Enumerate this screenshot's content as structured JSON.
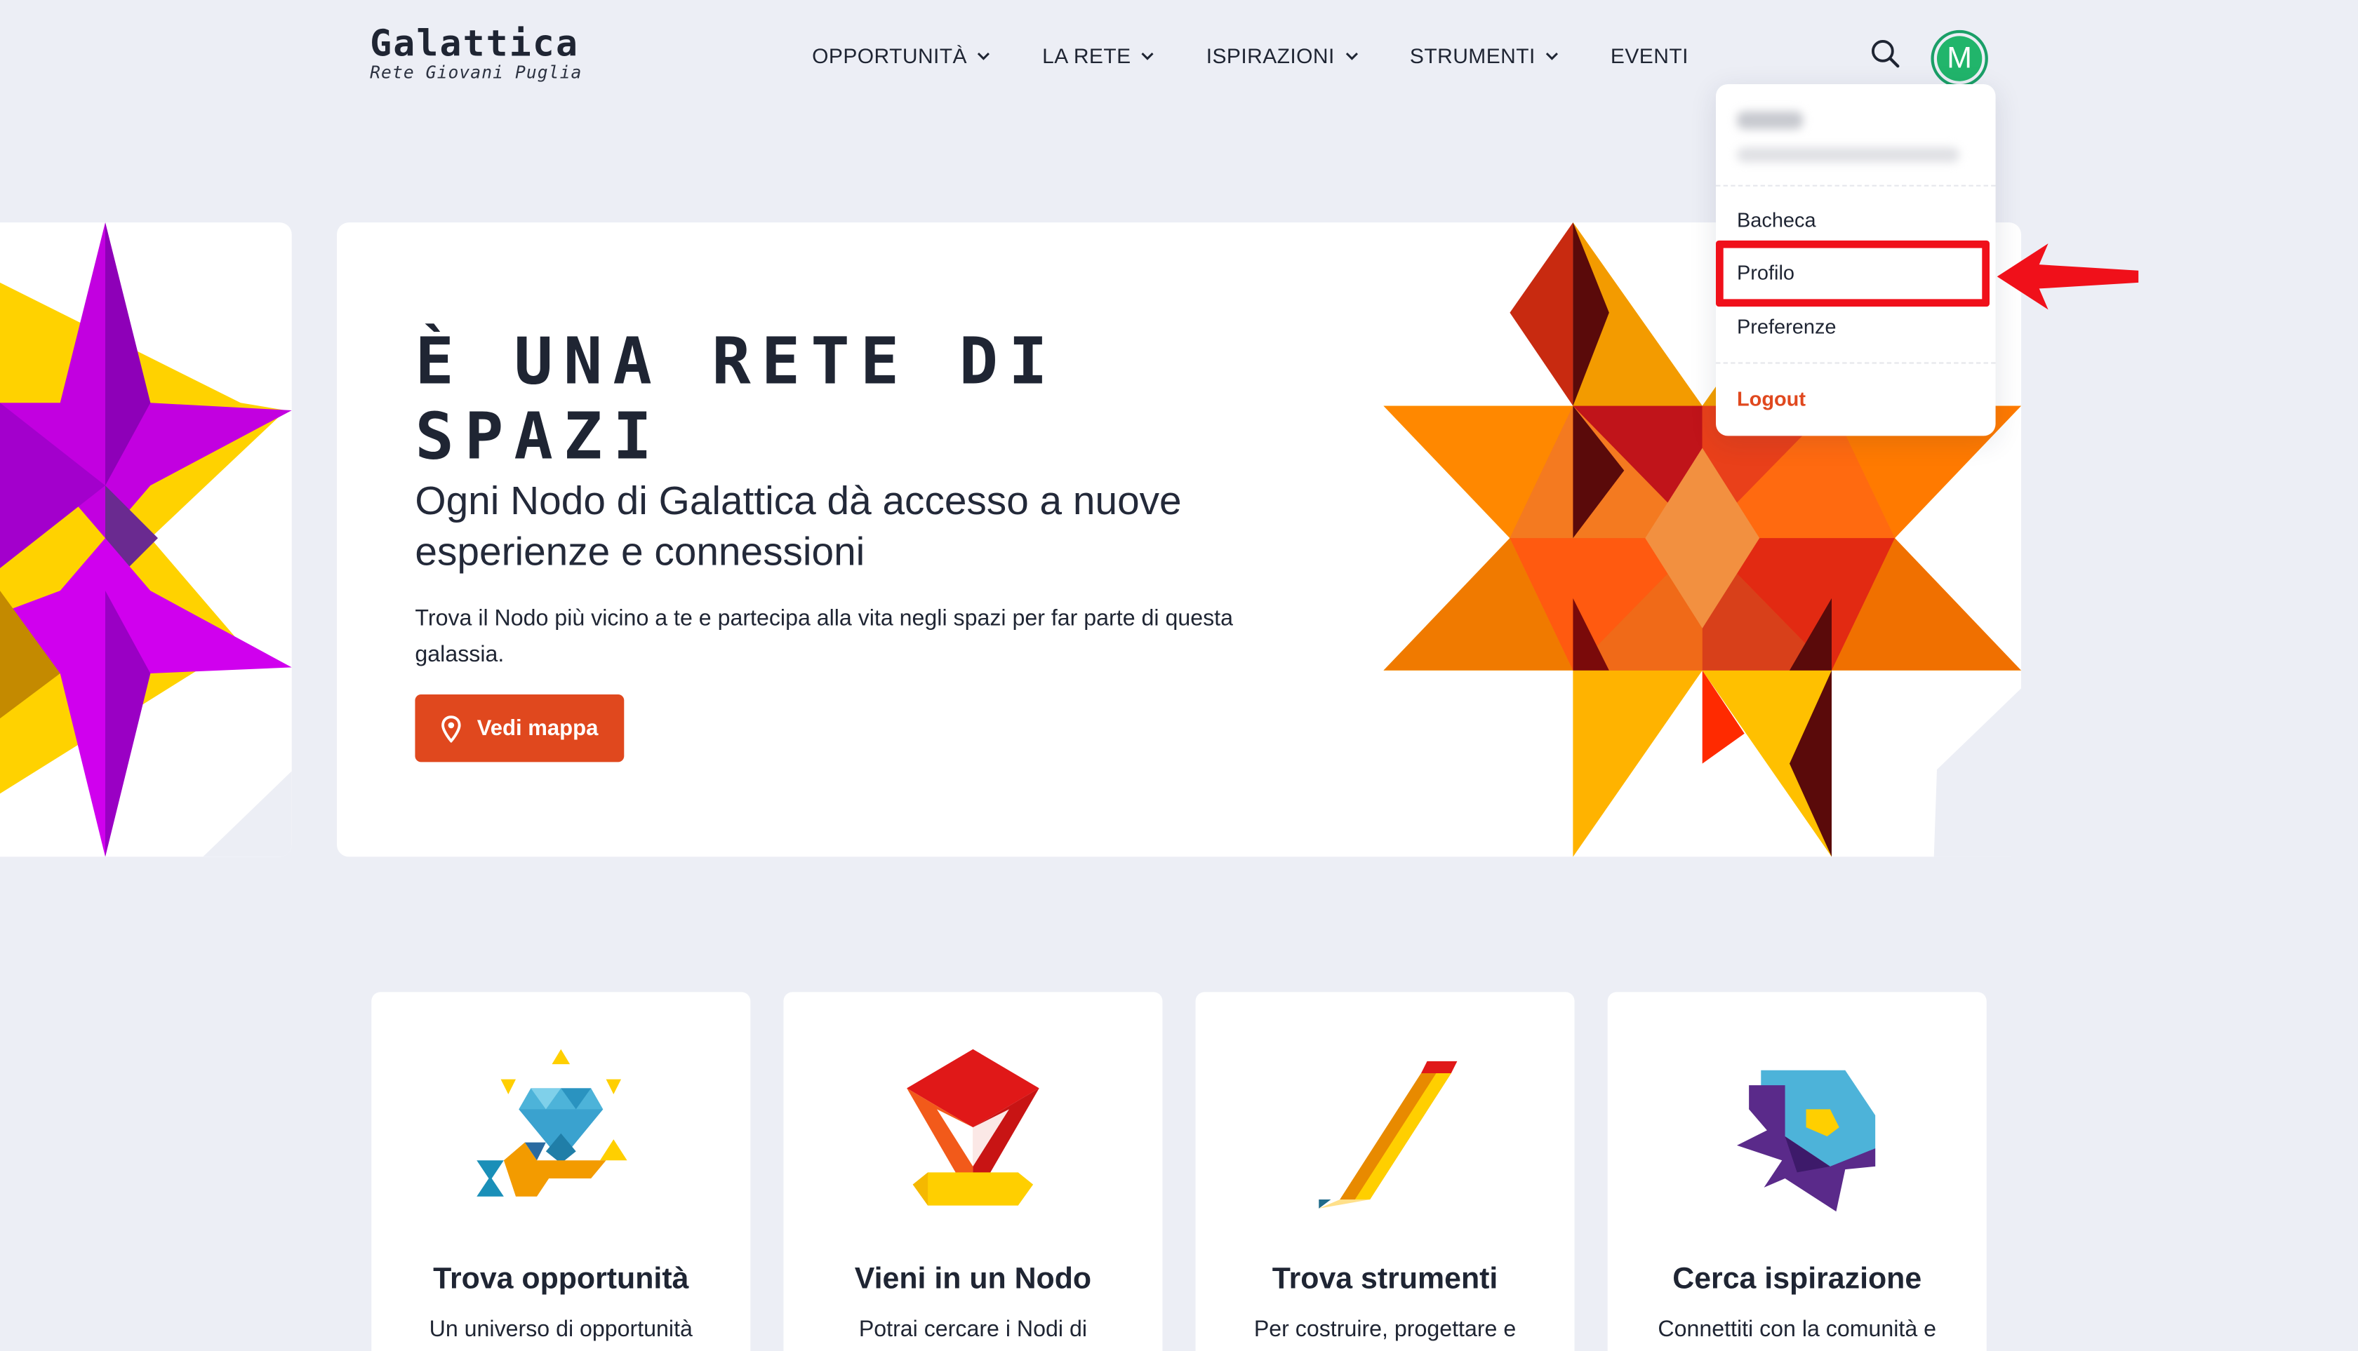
{
  "header": {
    "logo_title": "Galattica",
    "logo_subtitle": "Rete Giovani Puglia",
    "nav": [
      {
        "label": "OPPORTUNITÀ",
        "has_dropdown": true
      },
      {
        "label": "LA RETE",
        "has_dropdown": true
      },
      {
        "label": "ISPIRAZIONI",
        "has_dropdown": true
      },
      {
        "label": "STRUMENTI",
        "has_dropdown": true
      },
      {
        "label": "EVENTI",
        "has_dropdown": false
      }
    ],
    "search_icon": "search-icon",
    "avatar_initial": "M"
  },
  "user_menu": {
    "items": {
      "dashboard": "Bacheca",
      "profile": "Profilo",
      "preferences": "Preferenze",
      "logout": "Logout"
    },
    "highlighted_item": "Profilo"
  },
  "hero": {
    "title": "È UNA RETE DI SPAZI",
    "subtitle": "Ogni Nodo di Galattica dà accesso a nuove esperienze e connessioni",
    "text": "Trova il Nodo più vicino a te e partecipa alla vita negli spazi per far parte di questa galassia.",
    "button_label": "Vedi mappa",
    "button_icon": "map-pin-icon"
  },
  "features": [
    {
      "title": "Trova opportunità",
      "text": "Un universo di opportunità",
      "icon": "diamond-key-icon"
    },
    {
      "title": "Vieni in un Nodo",
      "text": "Potrai cercare i Nodi di",
      "icon": "location-pin-icon"
    },
    {
      "title": "Trova strumenti",
      "text": "Per costruire, progettare e",
      "icon": "pencil-icon"
    },
    {
      "title": "Cerca ispirazione",
      "text": "Connettiti con la comunità e",
      "icon": "speech-bubble-icon"
    }
  ],
  "colors": {
    "accent": "#e0481e",
    "background": "#eceef5",
    "avatar": "#21b56b",
    "annotation": "#f0101a"
  }
}
